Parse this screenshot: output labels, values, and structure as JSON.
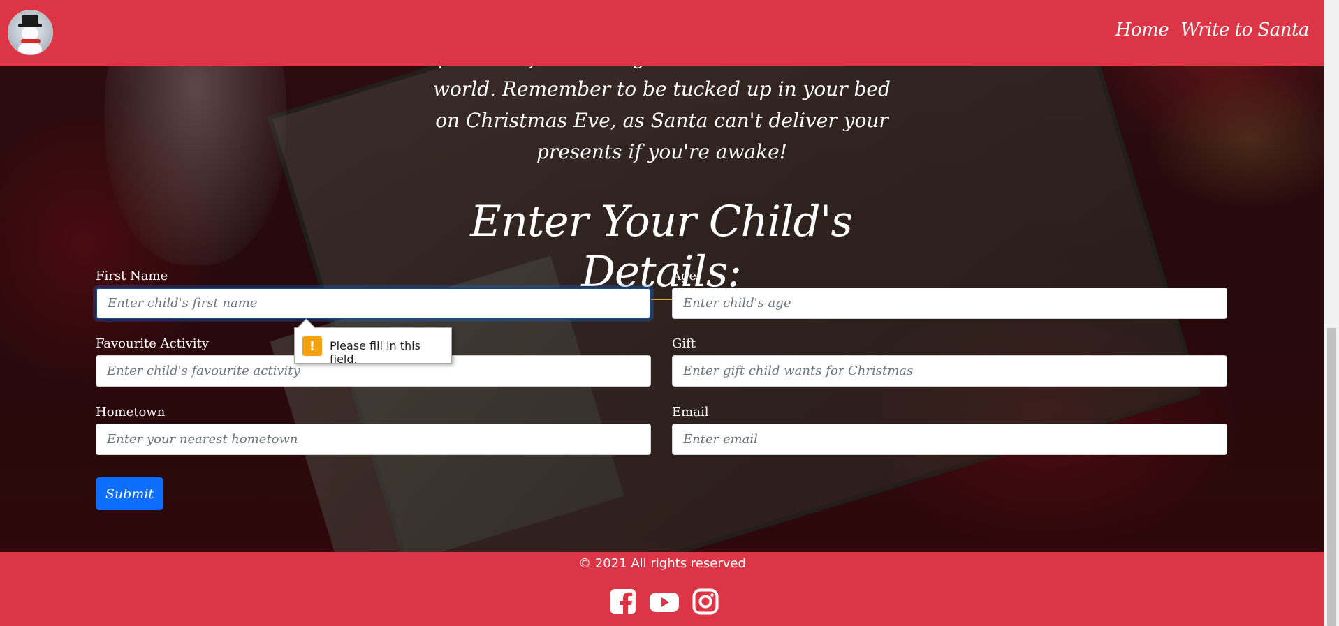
{
  "nav": {
    "home": "Home",
    "write": "Write to Santa"
  },
  "intro": {
    "line1": "presents for all the good children around the",
    "line2": "world. Remember to be tucked up in your bed",
    "line3": "on Christmas Eve, as Santa can't deliver your",
    "line4": "presents if you're awake!"
  },
  "form": {
    "heading": "Enter Your Child's Details:",
    "first_name": {
      "label": "First Name",
      "placeholder": "Enter child's first name",
      "value": ""
    },
    "age": {
      "label": "Age",
      "placeholder": "Enter child's age",
      "value": ""
    },
    "activity": {
      "label": "Favourite Activity",
      "placeholder": "Enter child's favourite activity",
      "value": ""
    },
    "gift": {
      "label": "Gift",
      "placeholder": "Enter gift child wants for Christmas",
      "value": ""
    },
    "hometown": {
      "label": "Hometown",
      "placeholder": "Enter your nearest hometown",
      "value": ""
    },
    "email": {
      "label": "Email",
      "placeholder": "Enter email",
      "value": ""
    },
    "submit": "Submit"
  },
  "tooltip": {
    "icon": "!",
    "message": "Please fill in this field."
  },
  "footer": {
    "copyright": "© 2021 All rights reserved",
    "icons": [
      "facebook-icon",
      "youtube-icon",
      "instagram-icon"
    ]
  },
  "colors": {
    "brand_red": "#dc3545",
    "submit_blue": "#0d6efd",
    "heading_underline": "#d4a72c",
    "warning": "#f5a00f"
  }
}
